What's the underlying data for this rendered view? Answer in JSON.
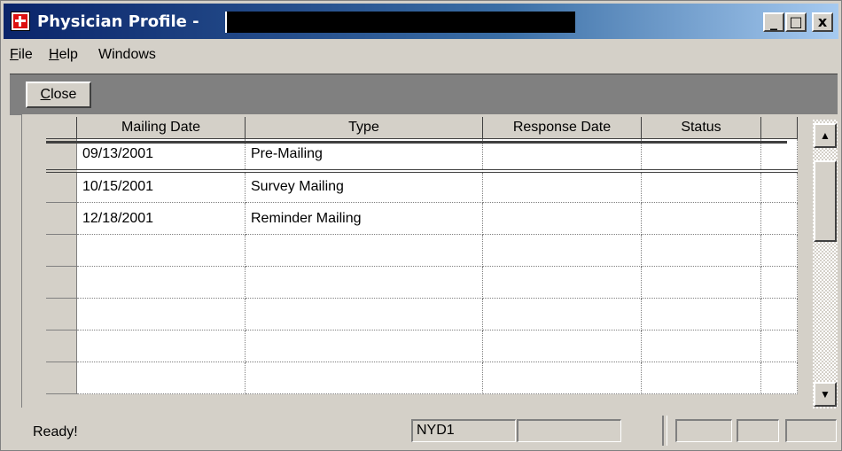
{
  "window": {
    "title": "Physician Profile -",
    "controls": {
      "minimize": "_",
      "maximize": "□",
      "close": "x"
    }
  },
  "menu": {
    "items": [
      {
        "label_u": "F",
        "label_rest": "ile"
      },
      {
        "label_u": "H",
        "label_rest": "elp"
      },
      {
        "label_u": "",
        "label_rest": "Windows"
      }
    ]
  },
  "toolbar": {
    "close_u": "C",
    "close_rest": "lose"
  },
  "grid": {
    "columns": [
      "Mailing Date",
      "Type",
      "Response Date",
      "Status"
    ],
    "rows": [
      [
        "09/13/2001",
        "Pre-Mailing",
        "",
        ""
      ],
      [
        "10/15/2001",
        "Survey Mailing",
        "",
        ""
      ],
      [
        "12/18/2001",
        "Reminder Mailing",
        "",
        ""
      ],
      [
        "",
        "",
        "",
        ""
      ],
      [
        "",
        "",
        "",
        ""
      ],
      [
        "",
        "",
        "",
        ""
      ],
      [
        "",
        "",
        "",
        ""
      ],
      [
        "",
        "",
        "",
        ""
      ]
    ]
  },
  "scrollbar": {
    "up": "▲",
    "down": "▼"
  },
  "status": {
    "text": "Ready!",
    "panel1": "NYD1",
    "panel2": ""
  }
}
